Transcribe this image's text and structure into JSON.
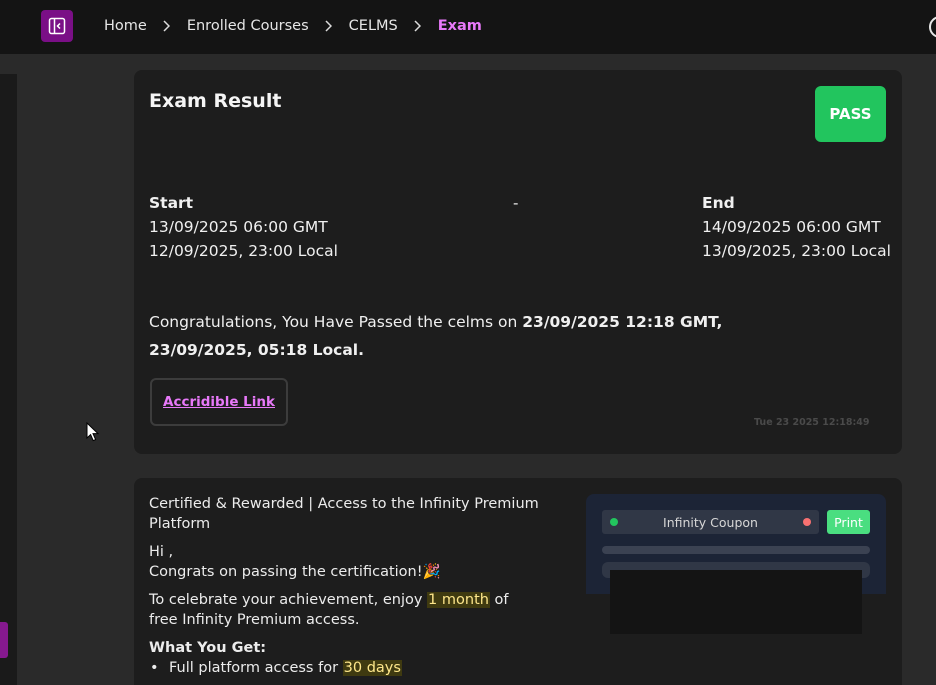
{
  "breadcrumb": {
    "home": "Home",
    "enrolled": "Enrolled Courses",
    "course": "CELMS",
    "current": "Exam"
  },
  "colors": {
    "accent": "#e879f9",
    "toggle_bg": "#7a0f86",
    "pass": "#22c55e"
  },
  "exam": {
    "title": "Exam Result",
    "status": "PASS",
    "start_label": "Start",
    "start_gmt": "13/09/2025 06:00 GMT",
    "start_local": "12/09/2025, 23:00 Local",
    "separator": "-",
    "end_label": "End",
    "end_gmt": "14/09/2025 06:00 GMT",
    "end_local": "13/09/2025, 23:00 Local",
    "congrats_prefix": "Congratulations, You Have Passed the celms on ",
    "passed_gmt": "23/09/2025 12:18 GMT,",
    "passed_local": "23/09/2025, 05:18 Local.",
    "link_label": "Accridible Link",
    "timestamp": "Tue 23 2025 12:18:49"
  },
  "promo": {
    "heading": "Certified & Rewarded | Access to the Infinity Premium Platform",
    "greeting": "Hi ,",
    "congrats": "Congrats on passing the certification!",
    "celebrate_prefix": "To celebrate your achievement, enjoy ",
    "celebrate_highlight": "1 month",
    "celebrate_suffix": " of free Infinity Premium access.",
    "what_you_get": "What You Get:",
    "benefit1_prefix": "Full platform access for ",
    "benefit1_highlight": "30 days"
  },
  "coupon": {
    "label": "Infinity Coupon",
    "print_label": "Print"
  },
  "icons": {
    "sidebar_toggle": "sidebar-collapse-icon",
    "separator": "chevron-right-icon",
    "party": "party-popper-icon",
    "user": "user-circle-icon",
    "cursor": "mouse-pointer-icon"
  }
}
